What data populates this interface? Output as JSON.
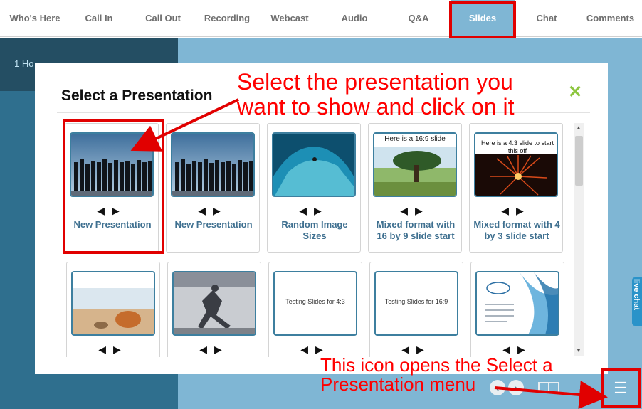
{
  "tabs": [
    {
      "label": "Who's Here",
      "active": false
    },
    {
      "label": "Call In",
      "active": false
    },
    {
      "label": "Call Out",
      "active": false
    },
    {
      "label": "Recording",
      "active": false
    },
    {
      "label": "Webcast",
      "active": false
    },
    {
      "label": "Audio",
      "active": false
    },
    {
      "label": "Q&A",
      "active": false
    },
    {
      "label": "Slides",
      "active": true
    },
    {
      "label": "Chat",
      "active": false
    },
    {
      "label": "Comments",
      "active": false
    }
  ],
  "background": {
    "host_label": "1 Ho",
    "live_chat_label": "live chat"
  },
  "modal": {
    "title": "Select a Presentation",
    "close_icon": "close-x-icon",
    "presentations": [
      {
        "name": "New Presentation",
        "thumb_kind": "crowd-sky"
      },
      {
        "name": "New Presentation",
        "thumb_kind": "crowd-sky"
      },
      {
        "name": "Random Image Sizes",
        "thumb_kind": "wave"
      },
      {
        "name": "Mixed format with 16 by 9 slide start",
        "thumb_kind": "tree",
        "thumb_text": "Here is a 16:9 slide"
      },
      {
        "name": "Mixed format with 4 by 3 slide start",
        "thumb_kind": "fireworks",
        "thumb_text": "Here is a 4:3 slide to start this off"
      },
      {
        "name": "",
        "thumb_kind": "beach"
      },
      {
        "name": "",
        "thumb_kind": "runner"
      },
      {
        "name": "",
        "thumb_kind": "text",
        "thumb_text": "Testing Slides for 4:3"
      },
      {
        "name": "",
        "thumb_kind": "text",
        "thumb_text": "Testing Slides for 16:9"
      },
      {
        "name": "",
        "thumb_kind": "blue-doc"
      }
    ],
    "slide_nav": {
      "prev": "◀",
      "next": "▶"
    }
  },
  "annotations": {
    "top_line1": "Select the presentation you",
    "top_line2": "want to show and click on it",
    "bottom_line1": "This icon opens the Select a",
    "bottom_line2": "Presentation menu"
  },
  "bottom_controls": {
    "prev": "‹",
    "next": "›",
    "list_icon_glyph": "☰"
  },
  "colors": {
    "accent": "#7fb6d4",
    "annotation_red": "#ff0000",
    "close_green": "#8dc63f",
    "card_text": "#3f7090"
  }
}
